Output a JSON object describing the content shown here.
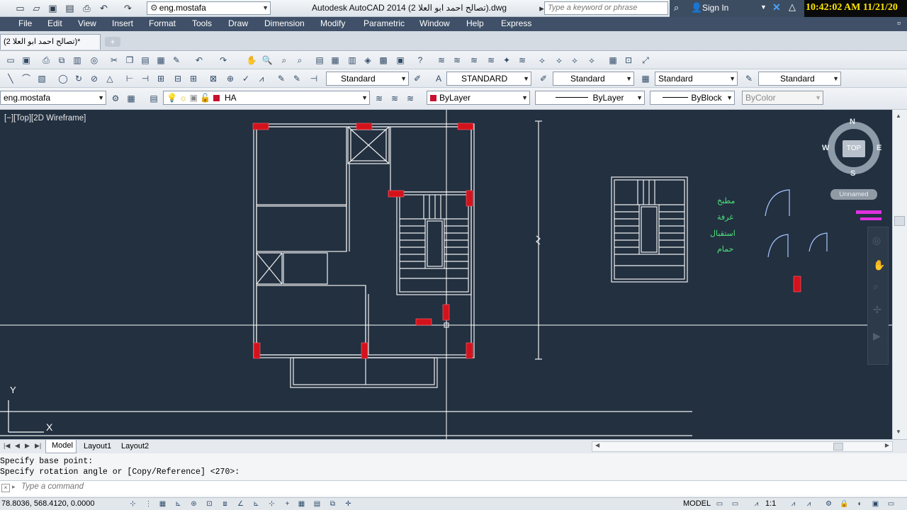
{
  "titlebar": {
    "workspace": "eng.mostafa",
    "app_title": "Autodesk AutoCAD 2014    (تصالح احمد ابو العلا 2).dwg",
    "search_placeholder": "Type a keyword or phrase",
    "sign_in": "Sign In",
    "clock": "10:42:02 AM 11/21/20"
  },
  "menu": [
    "File",
    "Edit",
    "View",
    "Insert",
    "Format",
    "Tools",
    "Draw",
    "Dimension",
    "Modify",
    "Parametric",
    "Window",
    "Help",
    "Express"
  ],
  "doc_tab": "(تصالح احمد ابو العلا 2)*",
  "styles_toolbar": {
    "text_style": "Standard",
    "dim_style": "STANDARD",
    "table_style": "Standard",
    "mleader_style": "Standard",
    "other_style": "Standard"
  },
  "layers_toolbar": {
    "workspace": "eng.mostafa",
    "layer": "HA",
    "color": "ByLayer",
    "linetype": "ByLayer",
    "lineweight": "ByBlock",
    "plotstyle": "ByColor"
  },
  "viewport": {
    "label": "[−][Top][2D Wireframe]",
    "nav_n": "N",
    "nav_s": "S",
    "nav_e": "E",
    "nav_w": "W",
    "nav_top": "TOP",
    "ucs_name": "Unnamed",
    "axis_y": "Y",
    "axis_x": "X",
    "room_labels": [
      "مطبخ",
      "غرفة",
      "استقبال",
      "حمام"
    ]
  },
  "layout_tabs": [
    "Model",
    "Layout1",
    "Layout2"
  ],
  "command": {
    "history": [
      "Specify base point:",
      "Specify rotation angle or [Copy/Reference] <270>:"
    ],
    "placeholder": "Type a command"
  },
  "status": {
    "coords": "78.8036, 568.4120, 0.0000",
    "model": "MODEL",
    "scale": "1:1"
  },
  "colors": {
    "canvas_bg": "#223040",
    "menubar": "#3f5068",
    "red_marker": "#d4121c",
    "arabic_text": "#4fe07a",
    "magenta": "#e030e0"
  }
}
